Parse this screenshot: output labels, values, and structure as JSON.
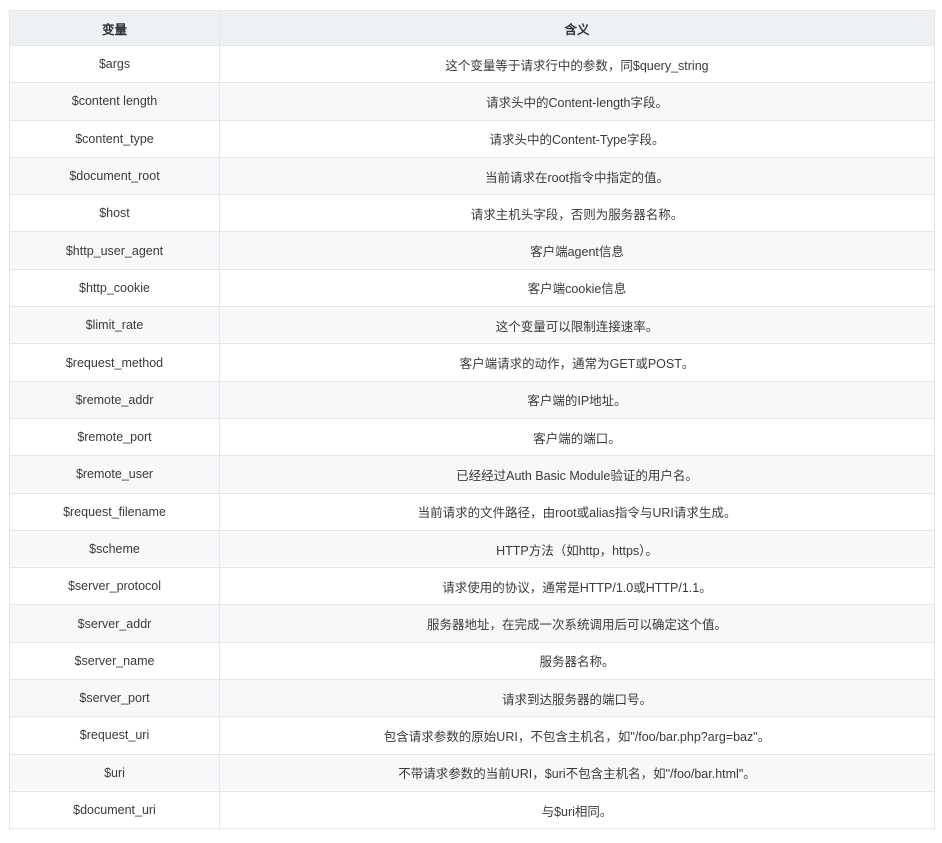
{
  "table": {
    "headers": {
      "variable": "变量",
      "meaning": "含义"
    },
    "rows": [
      {
        "variable": "$args",
        "meaning": "这个变量等于请求行中的参数，同$query_string"
      },
      {
        "variable": "$content length",
        "meaning": "请求头中的Content-length字段。"
      },
      {
        "variable": "$content_type",
        "meaning": "请求头中的Content-Type字段。"
      },
      {
        "variable": "$document_root",
        "meaning": "当前请求在root指令中指定的值。"
      },
      {
        "variable": "$host",
        "meaning": "请求主机头字段，否则为服务器名称。"
      },
      {
        "variable": "$http_user_agent",
        "meaning": "客户端agent信息"
      },
      {
        "variable": "$http_cookie",
        "meaning": "客户端cookie信息"
      },
      {
        "variable": "$limit_rate",
        "meaning": "这个变量可以限制连接速率。"
      },
      {
        "variable": "$request_method",
        "meaning": "客户端请求的动作，通常为GET或POST。"
      },
      {
        "variable": "$remote_addr",
        "meaning": "客户端的IP地址。"
      },
      {
        "variable": "$remote_port",
        "meaning": "客户端的端口。"
      },
      {
        "variable": "$remote_user",
        "meaning": "已经经过Auth Basic Module验证的用户名。"
      },
      {
        "variable": "$request_filename",
        "meaning": "当前请求的文件路径，由root或alias指令与URI请求生成。"
      },
      {
        "variable": "$scheme",
        "meaning": "HTTP方法（如http，https）。"
      },
      {
        "variable": "$server_protocol",
        "meaning": "请求使用的协议，通常是HTTP/1.0或HTTP/1.1。"
      },
      {
        "variable": "$server_addr",
        "meaning": "服务器地址，在完成一次系统调用后可以确定这个值。"
      },
      {
        "variable": "$server_name",
        "meaning": "服务器名称。"
      },
      {
        "variable": "$server_port",
        "meaning": "请求到达服务器的端口号。"
      },
      {
        "variable": "$request_uri",
        "meaning": "包含请求参数的原始URI，不包含主机名，如\"/foo/bar.php?arg=baz\"。"
      },
      {
        "variable": "$uri",
        "meaning": "不带请求参数的当前URI，$uri不包含主机名，如\"/foo/bar.html\"。"
      },
      {
        "variable": "$document_uri",
        "meaning": "与$uri相同。"
      }
    ]
  }
}
